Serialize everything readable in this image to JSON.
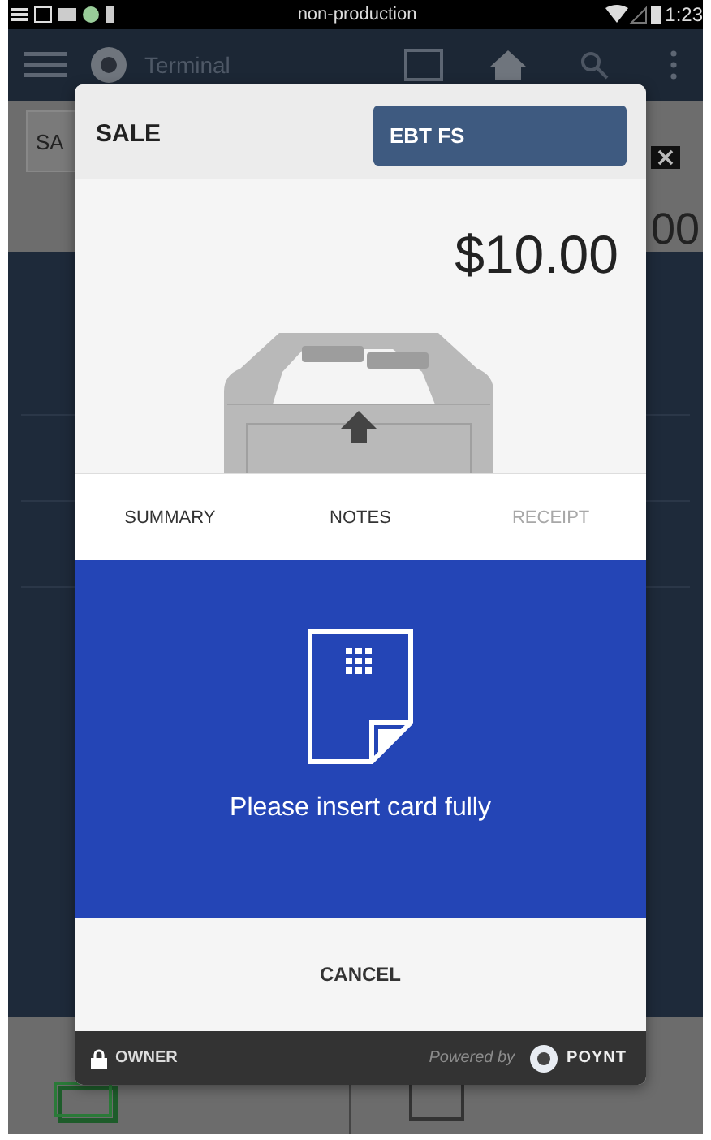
{
  "status_bar": {
    "label": "non-production",
    "time": "1:23"
  },
  "app_bar": {
    "title": "Terminal"
  },
  "background": {
    "field_text": "SA",
    "amount_text": "00"
  },
  "bottom_buttons": [
    {
      "kind": "cash"
    },
    {
      "kind": "charge"
    }
  ],
  "dialog": {
    "title": "SALE",
    "tender": "EBT FS",
    "amount": "$10.00",
    "tabs": [
      {
        "label": "SUMMARY",
        "disabled": false
      },
      {
        "label": "NOTES",
        "disabled": false
      },
      {
        "label": "RECEIPT",
        "disabled": true
      }
    ],
    "prompt": "Please insert card fully",
    "cancel": "CANCEL",
    "footer": {
      "user": "OWNER",
      "powered_by": "Powered by",
      "brand": "POYNT"
    }
  }
}
